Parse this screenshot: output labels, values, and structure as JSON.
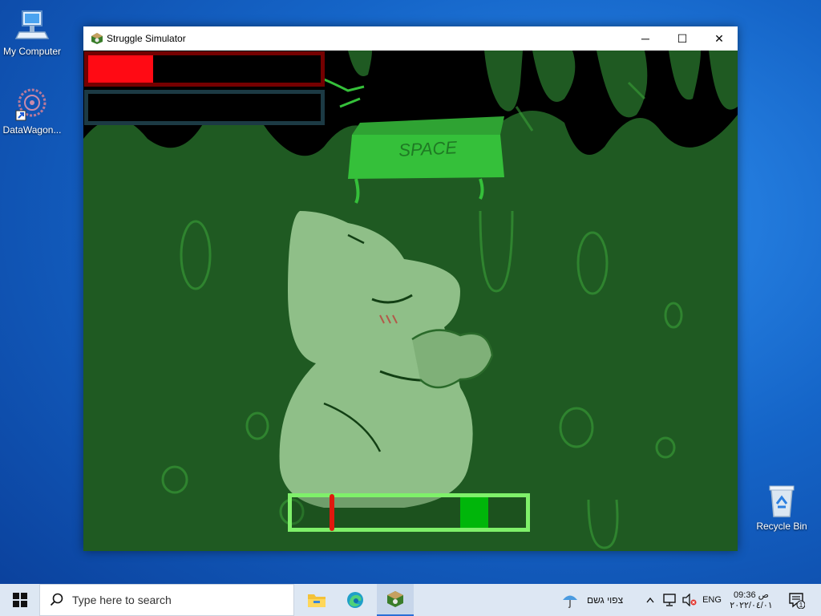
{
  "desktop": {
    "icons": [
      {
        "label": "My Computer"
      },
      {
        "label": "DataWagon..."
      },
      {
        "label": "Recycle Bin"
      }
    ]
  },
  "window": {
    "title": "Struggle Simulator",
    "controls": {
      "minimize": "─",
      "maximize": "☐",
      "close": "✕"
    }
  },
  "game": {
    "prompt_key": "SPACE",
    "health_fill": 0.28,
    "second_bar_fill": 0,
    "qte": {
      "target_start": 0.72,
      "target_end": 0.84,
      "marker": 0.16
    },
    "colors": {
      "health": "#ff0a14",
      "health_border": "#740000",
      "qte_border": "#7ff06a",
      "qte_zone": "#00b60a",
      "marker": "#e0180e",
      "slime": "#1f5a22"
    }
  },
  "taskbar": {
    "search_placeholder": "Type here to search",
    "weather_text": "צפוי גשם",
    "language": "ENG",
    "time": "09:36 ص",
    "date": "٢٠٢٢/٠٤/٠١",
    "notification_count": "1",
    "icons": [
      "windows-start-icon",
      "search-icon",
      "file-explorer-icon",
      "edge-icon",
      "struggle-simulator-icon",
      "umbrella-icon",
      "chevron-up-icon",
      "network-icon",
      "speaker-muted-icon",
      "notification-icon"
    ]
  }
}
